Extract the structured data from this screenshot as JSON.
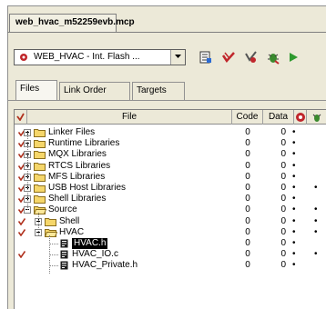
{
  "window": {
    "title": "web_hvac_m52259evb.mcp"
  },
  "toolbar": {
    "target_value": "WEB_HVAC - Int. Flash ...",
    "icons": [
      "target-settings-icon",
      "synchronize-icon",
      "make-icon",
      "debug-icon",
      "run-icon"
    ]
  },
  "tabs": [
    "Files",
    "Link Order",
    "Targets"
  ],
  "columns": {
    "file": "File",
    "code": "Code",
    "data": "Data"
  },
  "colors": {
    "accent_red": "#b0301d",
    "selection": "#000000",
    "folder": "#f5d66a"
  },
  "rows": [
    {
      "name": "Linker Files",
      "code": "0",
      "data": "0",
      "dot1": "•",
      "dot2": ""
    },
    {
      "name": "Runtime Libraries",
      "code": "0",
      "data": "0",
      "dot1": "•",
      "dot2": ""
    },
    {
      "name": "MQX Libraries",
      "code": "0",
      "data": "0",
      "dot1": "•",
      "dot2": ""
    },
    {
      "name": "RTCS Libraries",
      "code": "0",
      "data": "0",
      "dot1": "•",
      "dot2": ""
    },
    {
      "name": "MFS Libraries",
      "code": "0",
      "data": "0",
      "dot1": "•",
      "dot2": ""
    },
    {
      "name": "USB Host Libraries",
      "code": "0",
      "data": "0",
      "dot1": "•",
      "dot2": "•"
    },
    {
      "name": "Shell Libraries",
      "code": "0",
      "data": "0",
      "dot1": "•",
      "dot2": ""
    },
    {
      "name": "Source",
      "code": "0",
      "data": "0",
      "dot1": "•",
      "dot2": "•"
    },
    {
      "name": "Shell",
      "code": "0",
      "data": "0",
      "dot1": "•",
      "dot2": "•"
    },
    {
      "name": "HVAC",
      "code": "0",
      "data": "0",
      "dot1": "•",
      "dot2": "•"
    },
    {
      "name": "HVAC.h",
      "code": "0",
      "data": "0",
      "dot1": "•",
      "dot2": ""
    },
    {
      "name": "HVAC_IO.c",
      "code": "0",
      "data": "0",
      "dot1": "•",
      "dot2": "•"
    },
    {
      "name": "HVAC_Private.h",
      "code": "0",
      "data": "0",
      "dot1": "•",
      "dot2": ""
    }
  ]
}
